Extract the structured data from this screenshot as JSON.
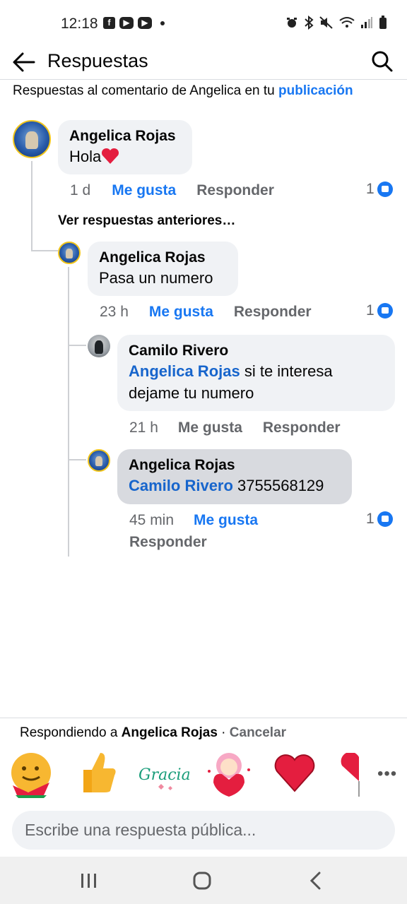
{
  "status_bar": {
    "time": "12:18",
    "apps": [
      "f",
      "▶",
      "▶"
    ]
  },
  "header": {
    "title": "Respuestas"
  },
  "context": {
    "prefix": "Respuestas al comentario de Angelica en tu ",
    "link": "publicación"
  },
  "comments": [
    {
      "name": "Angelica Rojas",
      "text": "Hola",
      "emoji": "heart-emoji",
      "time": "1 d",
      "like": "Me gusta",
      "reply": "Responder",
      "likes": "1"
    },
    {
      "name": "Angelica Rojas",
      "text": "Pasa un numero",
      "time": "23 h",
      "like": "Me gusta",
      "reply": "Responder",
      "likes": "1"
    },
    {
      "name": "Camilo Rivero",
      "mention": "Angelica Rojas",
      "text_line1": " si te interesa",
      "text_line2": "dejame tu numero",
      "time": "21 h",
      "like": "Me gusta",
      "reply": "Responder"
    },
    {
      "name": "Angelica Rojas",
      "mention": "Camilo Rivero",
      "text": " 3755568129",
      "time": "45 min",
      "like": "Me gusta",
      "reply": "Responder",
      "likes": "1"
    }
  ],
  "more_replies": "Ver respuestas anteriores…",
  "replying": {
    "prefix": "Respondiendo a ",
    "name": "Angelica Rojas",
    "sep": " · ",
    "cancel": "Cancelar"
  },
  "stickers": [
    "hug-emoji-sticker",
    "thumbs-up-sticker",
    "gracias-sticker",
    "girl-heart-sticker",
    "red-heart-sticker",
    "balloon-heart-sticker"
  ],
  "sticker_text": {
    "gracias": "Gracias"
  },
  "input": {
    "placeholder": "Escribe una respuesta pública..."
  },
  "colors": {
    "link_blue": "#1877f2",
    "bubble": "#f0f2f5",
    "selected_bubble": "#d8dadf",
    "meta_gray": "#65676b"
  }
}
